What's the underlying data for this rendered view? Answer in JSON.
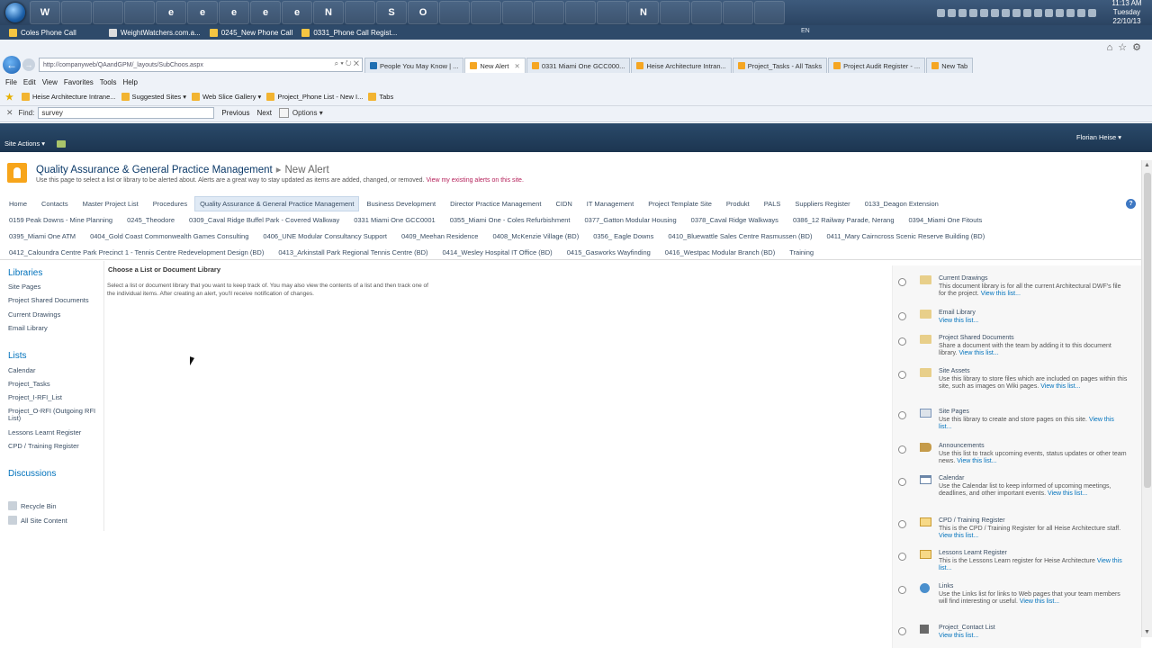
{
  "taskbar": {
    "apps": [
      "W",
      "",
      "",
      "",
      "e",
      "e",
      "e",
      "e",
      "e",
      "N",
      "",
      "S",
      "O",
      "",
      "",
      "",
      "",
      "",
      "",
      "N",
      "",
      "",
      "",
      ""
    ],
    "clock_time": "11:13 AM",
    "clock_day": "Tuesday",
    "clock_date": "22/10/13",
    "jump_items": [
      "Coles Phone Call",
      "WeightWatchers.com.a...",
      "0245_New Phone Call",
      "0331_Phone Call Regist..."
    ],
    "lang": "EN"
  },
  "browser": {
    "address": "http://companyweb/QAandGPM/_layouts/SubChoos.aspx",
    "tabs": [
      {
        "label": "People You May Know | ...",
        "active": false
      },
      {
        "label": "New Alert",
        "active": true
      },
      {
        "label": "0331 Miami One GCC000...",
        "active": false
      },
      {
        "label": "Heise Architecture Intran...",
        "active": false
      },
      {
        "label": "Project_Tasks - All Tasks",
        "active": false
      },
      {
        "label": "Project Audit Register - ...",
        "active": false
      },
      {
        "label": "New Tab",
        "active": false
      }
    ],
    "menu": [
      "File",
      "Edit",
      "View",
      "Favorites",
      "Tools",
      "Help"
    ],
    "favorites": [
      "Heise Architecture Intrane...",
      "Suggested Sites ▾",
      "Web Slice Gallery ▾",
      "Project_Phone List - New I...",
      "Tabs"
    ],
    "find_label": "Find:",
    "find_value": "survey",
    "find_prev": "Previous",
    "find_next": "Next",
    "find_options": "Options ▾"
  },
  "sp": {
    "site_actions": "Site Actions ▾",
    "user": "Florian Heise ▾",
    "site_title": "Quality Assurance & General Practice Management",
    "page_name": "New Alert",
    "description": "Use this page to select a list or library to be alerted about. Alerts are a great way to stay updated as items are added, changed, or removed.",
    "description_link": "View my existing alerts on this site.",
    "nav_row1": [
      "Home",
      "Contacts",
      "Master Project List",
      "Procedures",
      "Quality Assurance & General Practice Management",
      "Business Development",
      "Director Practice Management",
      "CIDN",
      "IT Management",
      "Project Template Site",
      "Produkt",
      "PALS",
      "Suppliers Register",
      "0133_Deagon Extension"
    ],
    "nav_row2": [
      "0159 Peak Downs - Mine Planning",
      "0245_Theodore",
      "0309_Caval Ridge Buffel Park - Covered Walkway",
      "0331 Miami One GCC0001",
      "0355_Miami One - Coles Refurbishment",
      "0377_Gatton Modular Housing",
      "0378_Caval Ridge Walkways",
      "0386_12 Railway Parade, Nerang",
      "0394_Miami One Fitouts"
    ],
    "nav_row3": [
      "0395_Miami One ATM",
      "0404_Gold Coast Commonwealth Games Consulting",
      "0406_UNE Modular Consultancy Support",
      "0409_Meehan Residence",
      "0408_McKenzie Village (BD)",
      "0356_ Eagle Downs",
      "0410_Bluewattle Sales Centre Rasmussen (BD)",
      "0411_Mary Cairncross Scenic Reserve Building (BD)"
    ],
    "nav_row4": [
      "0412_Caloundra Centre Park Precinct 1 - Tennis Centre Redevelopment Design (BD)",
      "0413_Arkinstall Park Regional Tennis Centre (BD)",
      "0414_Wesley Hospital IT Office (BD)",
      "0415_Gasworks Wayfinding",
      "0416_Westpac Modular Branch (BD)",
      "Training"
    ],
    "quicklaunch": {
      "libraries_head": "Libraries",
      "libraries": [
        "Site Pages",
        "Project Shared Documents",
        "Current Drawings",
        "Email Library"
      ],
      "lists_head": "Lists",
      "lists": [
        "Calendar",
        "Project_Tasks",
        "Project_I-RFI_List",
        "Project_O-RFI (Outgoing RFI List)",
        "Lessons Learnt Register",
        "CPD / Training Register"
      ],
      "discussions_head": "Discussions",
      "recycle_bin": "Recycle Bin",
      "all_site_content": "All Site Content"
    },
    "main_title": "Choose a List or Document Library",
    "main_desc": "Select a list or document library that you want to keep track of. You may also view the contents of a list and then track one of the individual items. After creating an alert, you'll receive notification of changes.",
    "chooser": [
      {
        "name": "Current Drawings",
        "desc": "This document library is for all the current Architectural DWF's file for the project.",
        "link": "View this list...",
        "icon": "folder-icon"
      },
      {
        "name": "Email Library",
        "desc": "",
        "link": "View this list...",
        "icon": "folder-icon"
      },
      {
        "name": "Project Shared Documents",
        "desc": "Share a document with the team by adding it to this document library.",
        "link": "View this list...",
        "icon": "folder-icon"
      },
      {
        "name": "Site Assets",
        "desc": "Use this library to store files which are included on pages within this site, such as images on Wiki pages.",
        "link": "View this list...",
        "icon": "folder-icon"
      },
      {
        "name": "Site Pages",
        "desc": "Use this library to create and store pages on this site.",
        "link": "View this list...",
        "icon": "page-icon"
      },
      {
        "name": "Announcements",
        "desc": "Use this list to track upcoming events, status updates or other team news.",
        "link": "View this list...",
        "icon": "announcement-icon"
      },
      {
        "name": "Calendar",
        "desc": "Use the Calendar list to keep informed of upcoming meetings, deadlines, and other important events.",
        "link": "View this list...",
        "icon": "calendar-icon"
      },
      {
        "name": "CPD / Training Register",
        "desc": "This is the CPD / Training Register for all Heise Architecture staff.",
        "link": "View this list...",
        "icon": "table-icon"
      },
      {
        "name": "Lessons Learnt Register",
        "desc": "This is the Lessons Learn register for Heise Architecture",
        "link": "View this list...",
        "icon": "table-icon"
      },
      {
        "name": "Links",
        "desc": "Use the Links list for links to Web pages that your team members will find interesting or useful.",
        "link": "View this list...",
        "icon": "links-icon"
      },
      {
        "name": "Project_Contact List",
        "desc": "",
        "link": "View this list...",
        "icon": "contact-icon"
      }
    ]
  }
}
